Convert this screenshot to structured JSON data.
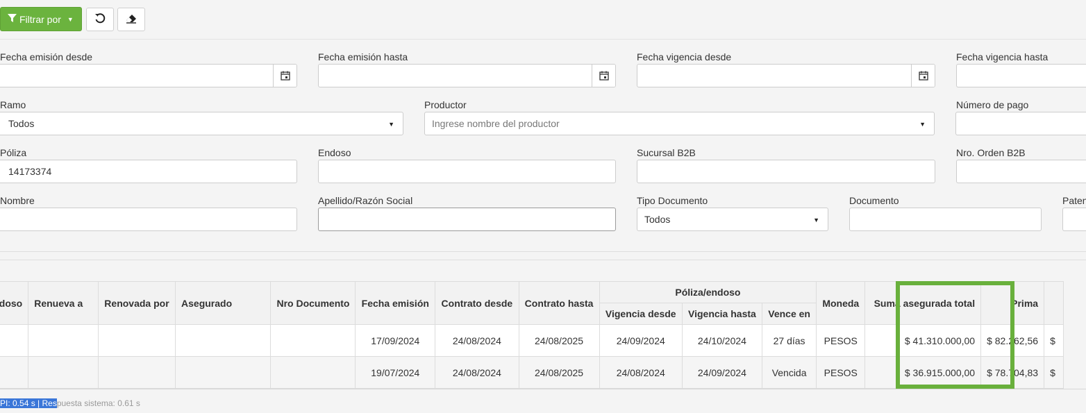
{
  "toolbar": {
    "filter_label": "Filtrar por",
    "icons": [
      "funnel-icon",
      "caret-down-icon",
      "undo-icon",
      "eraser-icon"
    ]
  },
  "form": {
    "fecha_emision_desde": {
      "label": "Fecha emisión desde",
      "value": ""
    },
    "fecha_emision_hasta": {
      "label": "Fecha emisión hasta",
      "value": ""
    },
    "fecha_vigencia_desde": {
      "label": "Fecha vigencia desde",
      "value": ""
    },
    "fecha_vigencia_hasta": {
      "label": "Fecha vigencia hasta",
      "value": ""
    },
    "ramo": {
      "label": "Ramo",
      "value": "Todos"
    },
    "productor": {
      "label": "Productor",
      "placeholder": "Ingrese nombre del productor"
    },
    "numero_pago": {
      "label": "Número de pago",
      "value": ""
    },
    "poliza": {
      "label": "Póliza",
      "value": "14173374"
    },
    "endoso": {
      "label": "Endoso",
      "value": ""
    },
    "sucursal_b2b": {
      "label": "Sucursal B2B",
      "value": ""
    },
    "nro_orden_b2b": {
      "label": "Nro. Orden B2B",
      "value": ""
    },
    "nombre": {
      "label": "Nombre",
      "value": ""
    },
    "apellido": {
      "label": "Apellido/Razón Social",
      "value": ""
    },
    "tipo_documento": {
      "label": "Tipo Documento",
      "value": "Todos"
    },
    "documento": {
      "label": "Documento",
      "value": ""
    },
    "patente": {
      "label": "Paten"
    }
  },
  "table": {
    "headers": {
      "endoso": "Endoso",
      "renueva_a": "Renueva a",
      "renovada_por": "Renovada por",
      "asegurado": "Asegurado",
      "nro_documento": "Nro Documento",
      "fecha_emision": "Fecha emisión",
      "contrato_desde": "Contrato desde",
      "contrato_hasta": "Contrato hasta",
      "group_poliza": "Póliza/endoso",
      "vigencia_desde": "Vigencia desde",
      "vigencia_hasta": "Vigencia hasta",
      "vence_en": "Vence en",
      "moneda": "Moneda",
      "suma_asegurada": "Suma asegurada total",
      "prima": "Prima"
    },
    "rows": [
      {
        "fecha_emision": "17/09/2024",
        "contrato_desde": "24/08/2024",
        "contrato_hasta": "24/08/2025",
        "vigencia_desde": "24/09/2024",
        "vigencia_hasta": "24/10/2024",
        "vence_en": "27 días",
        "moneda": "PESOS",
        "suma": "$ 41.310.000,00",
        "prima": "$ 82.262,56",
        "extra": "$"
      },
      {
        "fecha_emision": "19/07/2024",
        "contrato_desde": "24/08/2024",
        "contrato_hasta": "24/08/2025",
        "vigencia_desde": "24/08/2024",
        "vigencia_hasta": "24/09/2024",
        "vence_en": "Vencida",
        "moneda": "PESOS",
        "suma": "$ 36.915.000,00",
        "prima": "$ 78.704,83",
        "extra": "$"
      }
    ]
  },
  "status": {
    "selected": "PI: 0.54 s | Res",
    "rest": "puesta sistema: 0.61 s"
  },
  "colors": {
    "accent": "#6bb33e",
    "highlight": "#69b03c"
  }
}
